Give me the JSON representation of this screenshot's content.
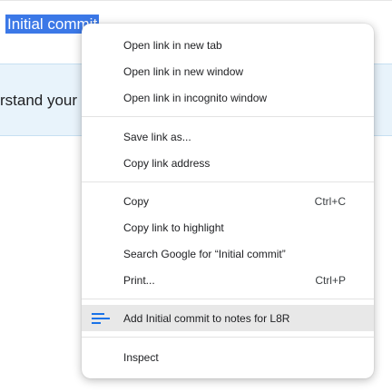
{
  "background": {
    "selected_text": "Initial commit",
    "banner_text": "rstand your"
  },
  "context_menu": {
    "open_new_tab": "Open link in new tab",
    "open_new_window": "Open link in new window",
    "open_incognito": "Open link in incognito window",
    "save_link_as": "Save link as...",
    "copy_link_address": "Copy link address",
    "copy": "Copy",
    "copy_shortcut": "Ctrl+C",
    "copy_link_highlight": "Copy link to highlight",
    "search_google": "Search Google for “Initial commit”",
    "print": "Print...",
    "print_shortcut": "Ctrl+P",
    "add_to_notes": "Add Initial commit to notes for L8R",
    "add_to_notes_icon": "notes-lines-icon",
    "inspect": "Inspect"
  },
  "colors": {
    "selection": "#3b78e7",
    "banner": "#e8f3fb",
    "hover": "#e8e8e8",
    "icon_accent": "#1a73e8"
  }
}
